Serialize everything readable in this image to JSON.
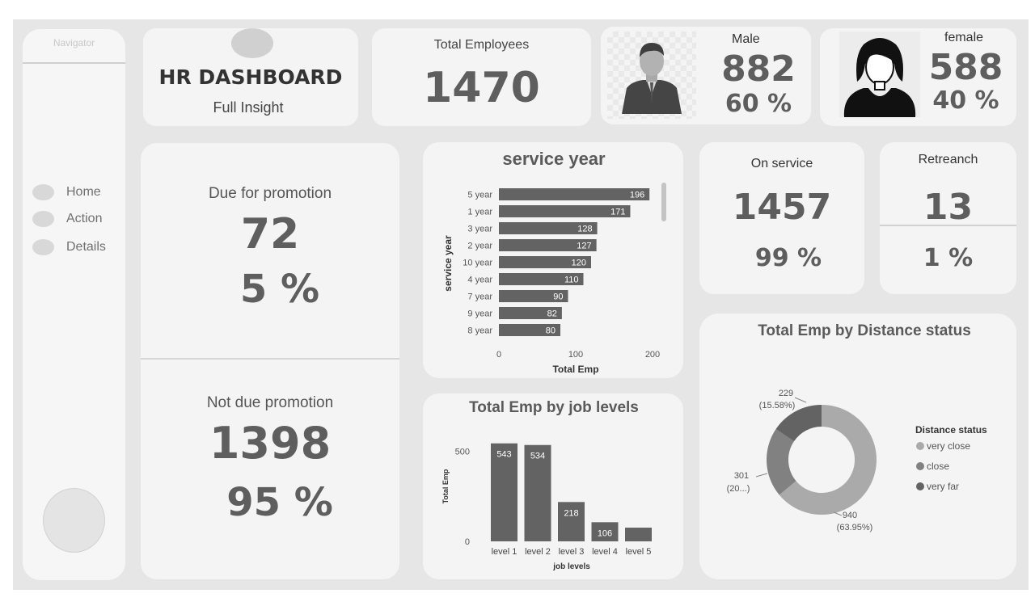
{
  "nav": {
    "title": "Navigator",
    "items": [
      {
        "label": "Home"
      },
      {
        "label": "Action"
      },
      {
        "label": "Details"
      }
    ]
  },
  "header": {
    "title": "HR DASHBOARD",
    "subtitle": "Full Insight"
  },
  "total": {
    "label": "Total Employees",
    "value": "1470"
  },
  "male": {
    "label": "Male",
    "value": "882",
    "pct": "60 %"
  },
  "female": {
    "label": "female",
    "value": "588",
    "pct": "40 %"
  },
  "promotion": {
    "due_label": "Due for promotion",
    "due_value": "72",
    "due_pct": "5 %",
    "not_label": "Not due promotion",
    "not_value": "1398",
    "not_pct": "95 %"
  },
  "on_service": {
    "label": "On service",
    "value": "1457",
    "pct": "99 %"
  },
  "retreanch": {
    "label": "Retreanch",
    "value": "13",
    "pct": "1 %"
  },
  "colors": {
    "bar": "#636363",
    "very_close": "#aaaaaa",
    "close": "#818181",
    "very_far": "#636363",
    "card": "#f4f4f4",
    "frame": "#e6e6e6"
  },
  "icons": {
    "male": "male-person-icon",
    "female": "female-person-icon"
  },
  "chart_data": [
    {
      "type": "bar",
      "orientation": "horizontal",
      "title": "service year",
      "xlabel": "Total Emp",
      "ylabel": "service year",
      "categories": [
        "5 year",
        "1 year",
        "3 year",
        "2 year",
        "10 year",
        "4 year",
        "7 year",
        "9 year",
        "8 year"
      ],
      "values": [
        196,
        171,
        128,
        127,
        120,
        110,
        90,
        82,
        80
      ],
      "xticks": [
        0,
        100,
        200
      ],
      "xlim": [
        0,
        200
      ]
    },
    {
      "type": "bar",
      "title": "Total Emp by job levels",
      "xlabel": "job levels",
      "ylabel": "Total Emp",
      "categories": [
        "level 1",
        "level 2",
        "level 3",
        "level 4",
        "level 5"
      ],
      "values": [
        543,
        534,
        218,
        106,
        76
      ],
      "data_labels": [
        "543",
        "534",
        "218",
        "106",
        ""
      ],
      "yticks": [
        0,
        500
      ],
      "ylim": [
        0,
        600
      ]
    },
    {
      "type": "pie",
      "title": "Total Emp by Distance status",
      "legend_title": "Distance status",
      "legend_position": "right",
      "labels": [
        "very close",
        "close",
        "very far"
      ],
      "values": [
        940,
        301,
        229
      ],
      "value_labels": [
        "940",
        "301",
        "229"
      ],
      "pct_labels": [
        "(63.95%)",
        "(20...)",
        "(15.58%)"
      ]
    }
  ]
}
